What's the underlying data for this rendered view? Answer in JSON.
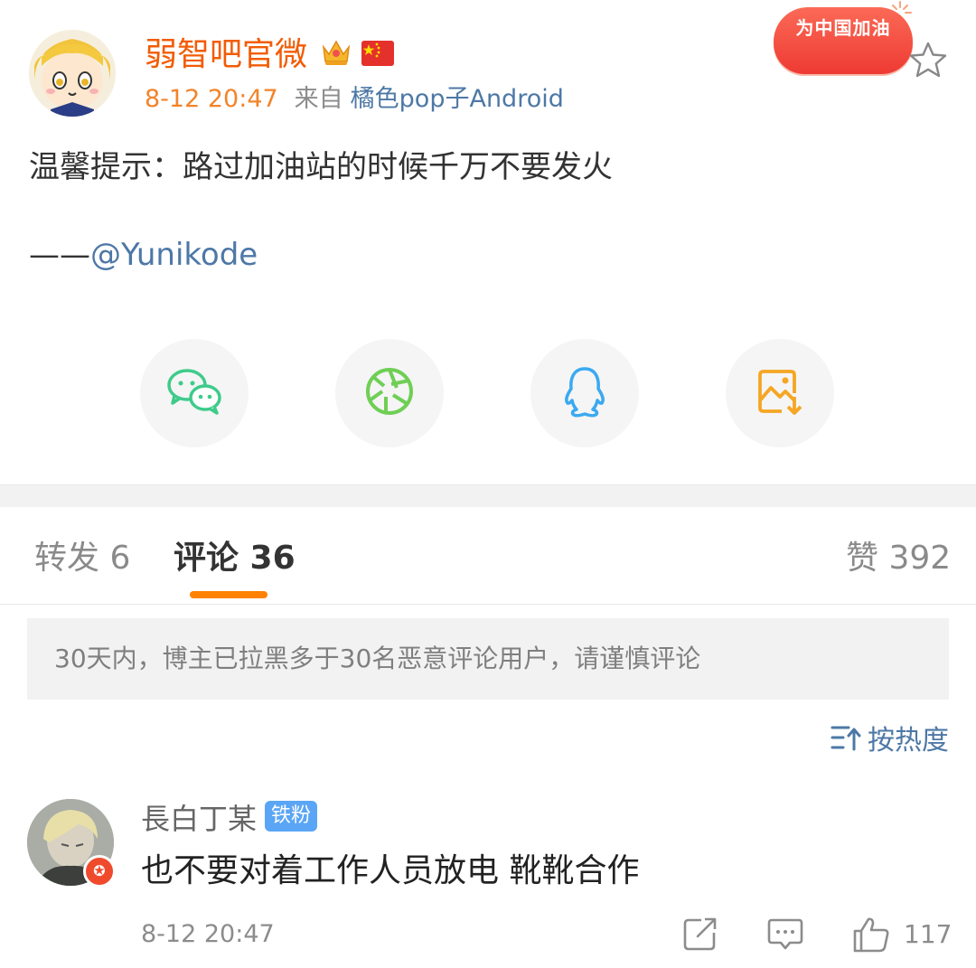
{
  "post": {
    "author_name": "弱智吧官微",
    "author_badges": [
      "crown-badge-icon",
      "china-flag-icon"
    ],
    "time": "8-12 20:47",
    "from_label": "来自",
    "device": "橘色pop子Android",
    "campaign_badge": "为中国加油",
    "text": "温馨提示：路过加油站的时候千万不要发火",
    "credit_dash": "——",
    "credit_mention": "@Yunikode"
  },
  "share_targets": [
    "wechat-icon",
    "moments-icon",
    "qq-icon",
    "save-image-icon"
  ],
  "tabs": {
    "repost": "转发 6",
    "comments": "评论 36",
    "likes": "赞 392"
  },
  "notice": "30天内，博主已拉黑多于30名恶意评论用户，请谨慎评论",
  "sort_label": "按热度",
  "comment": {
    "user": "長白丁某",
    "fan_badge": "铁粉",
    "text": "也不要对着工作人员放电 靴靴合作",
    "time": "8-12 20:47",
    "like_count": "117"
  },
  "colors": {
    "accent_orange": "#ff8200",
    "author_orange": "#f25c05",
    "link_blue": "#4d78a6",
    "fan_blue": "#5aa5f5",
    "badge_red": "#ee3a33"
  }
}
